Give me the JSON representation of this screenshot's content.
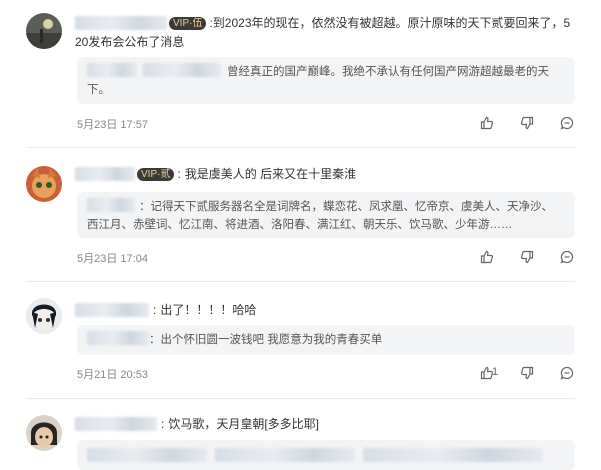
{
  "comments": [
    {
      "vip_badge": "VIP·伍",
      "text_line1": "到2023年的现在，依然没有被超越。原汁原味的天下贰要回来了，5",
      "text_line2": "20发布会公布了消息",
      "reply_text_line1": "曾经真正的国产巅峰。我绝不承认有任何国产网游超越最老的天",
      "reply_text_line2": "下。",
      "date": "5月23日 17:57",
      "likes": ""
    },
    {
      "vip_badge": "VIP·贰",
      "text_line1": "我是虞美人的 后来又在十里秦淮",
      "reply_text_line1": "记得天下贰服务器名全是词牌名，蝶恋花、凤求凰、忆帝京、虞美人、天净沙、",
      "reply_text_line2": "西江月、赤壁词、忆江南、将进酒、洛阳春、满江红、朝天乐、饮马歌、少年游……",
      "date": "5月23日 17:04",
      "likes": ""
    },
    {
      "text_line1": "出了！！！！哈哈",
      "reply_text_line1": "出个怀旧圆一波钱吧 我愿意为我的青春买单",
      "date": "5月21日 20:53",
      "likes": "1"
    },
    {
      "text_line1": "饮马歌，天月皇朝[多多比耶]"
    }
  ],
  "colors": {
    "vip_bg": "#3a3a3a",
    "vip_text": "#f2d38a",
    "reply_bg": "#f3f4f6"
  },
  "icons": [
    "thumbs-up-icon",
    "thumbs-down-icon",
    "comment-icon"
  ]
}
